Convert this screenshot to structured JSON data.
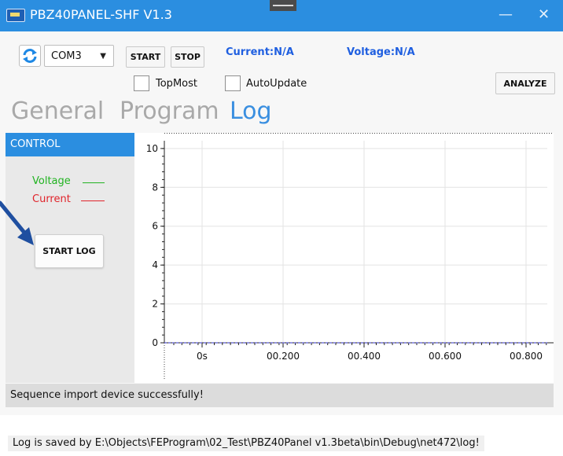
{
  "window": {
    "title": "PBZ40PANEL-SHF V1.3",
    "minimize_glyph": "—",
    "close_glyph": "✕"
  },
  "toolbar": {
    "port_value": "COM3",
    "start_label": "START",
    "stop_label": "STOP",
    "current_status": "Current:N/A",
    "voltage_status": "Voltage:N/A",
    "topmost_label": "TopMost",
    "autoupdate_label": "AutoUpdate",
    "analyze_label": "ANALYZE"
  },
  "tabs": [
    {
      "label": "General",
      "active": false
    },
    {
      "label": "Program",
      "active": false
    },
    {
      "label": "Log",
      "active": true
    }
  ],
  "control": {
    "header": "CONTROL",
    "voltage_label": "Voltage",
    "current_label": "Current",
    "start_log_label": "START LOG"
  },
  "colors": {
    "accent": "#2b8ee0",
    "voltage": "#21b321",
    "current": "#e0242b",
    "annotation_arrow": "#1f4fa0"
  },
  "chart_data": {
    "type": "line",
    "y_ticks": [
      "0",
      "2",
      "4",
      "6",
      "8",
      "10"
    ],
    "x_ticks": [
      "0s",
      "00.200",
      "00.400",
      "00.600",
      "00.800"
    ],
    "series": [
      {
        "name": "Voltage",
        "color": "#21b321",
        "values": []
      },
      {
        "name": "Current",
        "color": "#e0242b",
        "values": []
      }
    ],
    "grid": true
  },
  "status_text": "Sequence import device successfully!",
  "bottom_message": "Log is saved by E:\\Objects\\FEProgram\\02_Test\\PBZ40Panel v1.3beta\\bin\\Debug\\net472\\log!"
}
